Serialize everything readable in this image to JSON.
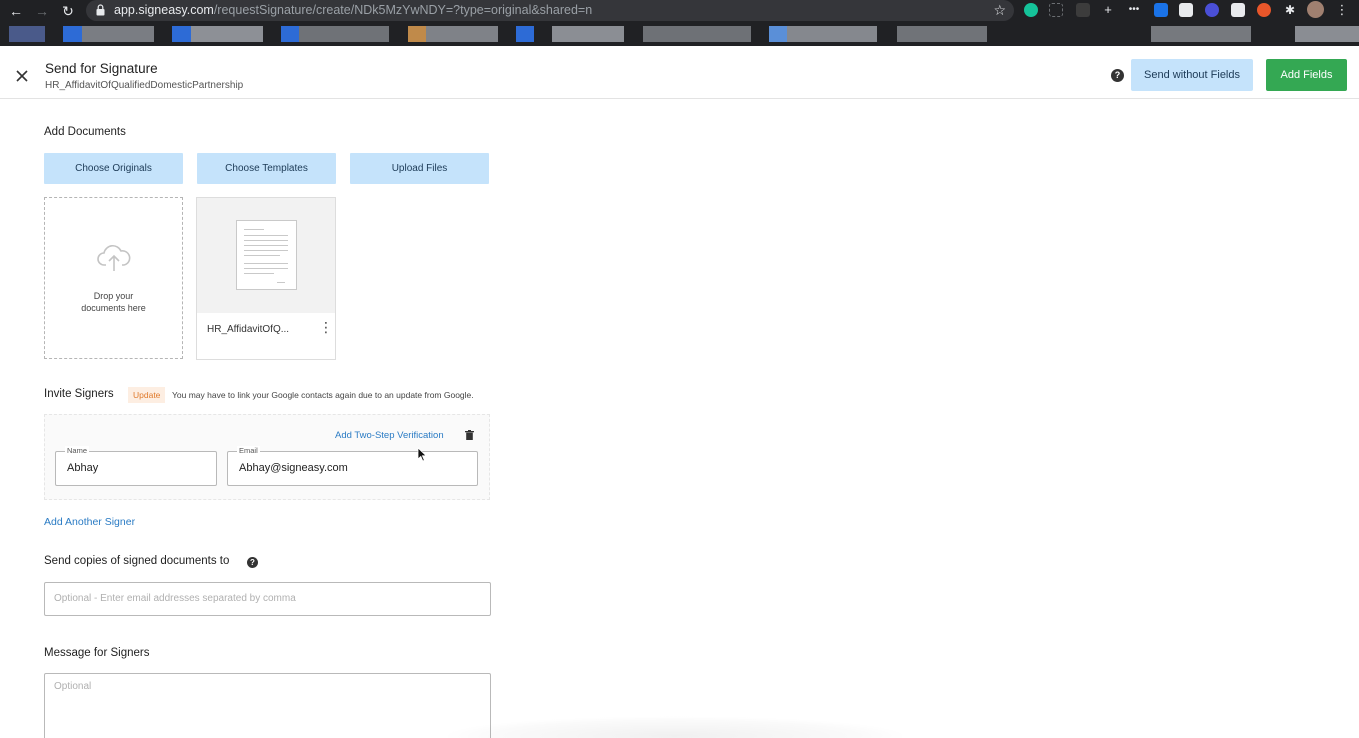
{
  "browser": {
    "url_domain": "app.signeasy.com",
    "url_path": "/requestSignature/create/NDk5MzYwNDY=?type=original&shared=n",
    "nav_icons": [
      "back-arrow-icon",
      "forward-arrow-icon",
      "reload-icon"
    ]
  },
  "header": {
    "title": "Send for Signature",
    "subtitle": "HR_AffidavitOfQualifiedDomesticPartnership",
    "help_icon": "?",
    "send_without_fields": "Send without Fields",
    "add_fields": "Add Fields"
  },
  "documents": {
    "section_label": "Add Documents",
    "choose_originals": "Choose Originals",
    "choose_templates": "Choose Templates",
    "upload_files": "Upload Files",
    "dropzone_text": "Drop your documents here",
    "doc_name": "HR_AffidavitOfQ..."
  },
  "signers": {
    "section_label": "Invite Signers",
    "update_badge": "Update",
    "update_note": "You may have to link your Google contacts again due to an update from Google.",
    "two_step": "Add Two-Step Verification",
    "name_label": "Name",
    "name_value": "Abhay",
    "email_label": "Email",
    "email_value": "Abhay@signeasy.com",
    "add_another": "Add Another Signer"
  },
  "copies": {
    "label": "Send copies of signed documents to",
    "placeholder": "Optional - Enter email addresses separated by comma"
  },
  "message": {
    "label": "Message for Signers",
    "placeholder": "Optional"
  },
  "colors": {
    "primary_light": "#c5e3fb",
    "primary_green": "#34a853",
    "link_blue": "#2a7bc4",
    "update_orange": "#e07a2c"
  }
}
